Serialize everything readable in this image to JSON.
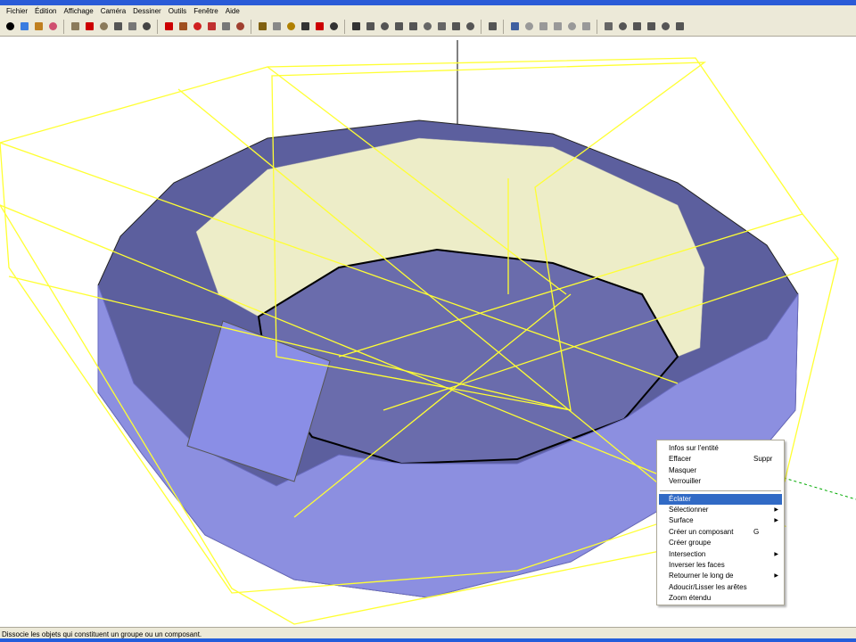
{
  "menubar": [
    "Fichier",
    "Édition",
    "Affichage",
    "Caméra",
    "Dessiner",
    "Outils",
    "Fenêtre",
    "Aide"
  ],
  "toolbar": {
    "icons": [
      "select-icon",
      "component-icon",
      "paint-bucket-icon",
      "eraser-icon",
      "rectangle-icon",
      "line-icon",
      "circle-icon",
      "arc-icon",
      "polygon-icon",
      "freehand-icon",
      "move-icon",
      "push-pull-icon",
      "rotate-icon",
      "follow-me-icon",
      "scale-icon",
      "offset-icon",
      "tape-measure-icon",
      "dimension-icon",
      "protractor-icon",
      "text-icon",
      "axes-icon",
      "3d-text-icon",
      "orbit-icon",
      "pan-icon",
      "zoom-icon",
      "zoom-window-icon",
      "zoom-extents-icon",
      "previous-view-icon",
      "next-view-icon",
      "walk-icon",
      "look-around-icon",
      "position-camera-icon",
      "iso-view-icon",
      "top-view-icon",
      "front-view-icon",
      "right-view-icon",
      "back-view-icon",
      "left-view-icon",
      "xray-icon",
      "wireframe-icon",
      "hidden-line-icon",
      "shaded-icon",
      "textured-icon",
      "monochrome-icon"
    ]
  },
  "context_menu": {
    "items": [
      {
        "label": "Infos sur l'entité"
      },
      {
        "label": "Effacer",
        "shortcut": "Suppr"
      },
      {
        "label": "Masquer"
      },
      {
        "label": "Verrouiller"
      },
      {
        "separator": true
      },
      {
        "label": "Éclater",
        "selected": true
      },
      {
        "label": "Sélectionner",
        "submenu": true
      },
      {
        "label": "Surface",
        "submenu": true
      },
      {
        "label": "Créer un composant",
        "shortcut": "G"
      },
      {
        "label": "Créer groupe"
      },
      {
        "label": "Intersection",
        "submenu": true
      },
      {
        "label": "Inverser les faces"
      },
      {
        "label": "Retourner le long de",
        "submenu": true
      },
      {
        "label": "Adoucir/Lisser les arêtes"
      },
      {
        "label": "Zoom étendu"
      }
    ]
  },
  "status": {
    "text": "Dissocie les objets qui constituent un groupe ou un composant."
  },
  "colors": {
    "ring_top": "#5c5f9e",
    "ring_wall": "#8c8fe0",
    "inner_wall": "#ededc8",
    "selection": "#ffff33",
    "menu_highlight": "#316ac5"
  }
}
